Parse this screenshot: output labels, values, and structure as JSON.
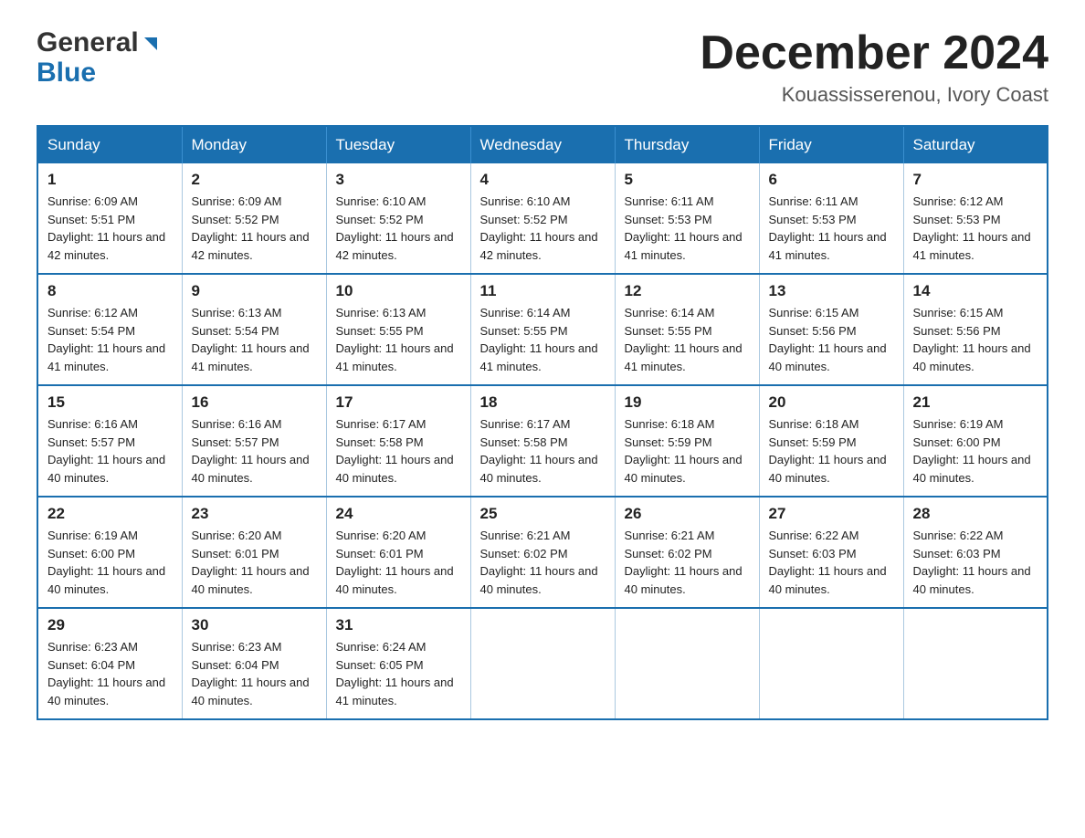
{
  "logo": {
    "general": "General",
    "blue": "Blue"
  },
  "title": {
    "month": "December 2024",
    "location": "Kouassisserenou, Ivory Coast"
  },
  "header_days": [
    "Sunday",
    "Monday",
    "Tuesday",
    "Wednesday",
    "Thursday",
    "Friday",
    "Saturday"
  ],
  "weeks": [
    [
      {
        "num": "1",
        "sunrise": "6:09 AM",
        "sunset": "5:51 PM",
        "daylight": "11 hours and 42 minutes."
      },
      {
        "num": "2",
        "sunrise": "6:09 AM",
        "sunset": "5:52 PM",
        "daylight": "11 hours and 42 minutes."
      },
      {
        "num": "3",
        "sunrise": "6:10 AM",
        "sunset": "5:52 PM",
        "daylight": "11 hours and 42 minutes."
      },
      {
        "num": "4",
        "sunrise": "6:10 AM",
        "sunset": "5:52 PM",
        "daylight": "11 hours and 42 minutes."
      },
      {
        "num": "5",
        "sunrise": "6:11 AM",
        "sunset": "5:53 PM",
        "daylight": "11 hours and 41 minutes."
      },
      {
        "num": "6",
        "sunrise": "6:11 AM",
        "sunset": "5:53 PM",
        "daylight": "11 hours and 41 minutes."
      },
      {
        "num": "7",
        "sunrise": "6:12 AM",
        "sunset": "5:53 PM",
        "daylight": "11 hours and 41 minutes."
      }
    ],
    [
      {
        "num": "8",
        "sunrise": "6:12 AM",
        "sunset": "5:54 PM",
        "daylight": "11 hours and 41 minutes."
      },
      {
        "num": "9",
        "sunrise": "6:13 AM",
        "sunset": "5:54 PM",
        "daylight": "11 hours and 41 minutes."
      },
      {
        "num": "10",
        "sunrise": "6:13 AM",
        "sunset": "5:55 PM",
        "daylight": "11 hours and 41 minutes."
      },
      {
        "num": "11",
        "sunrise": "6:14 AM",
        "sunset": "5:55 PM",
        "daylight": "11 hours and 41 minutes."
      },
      {
        "num": "12",
        "sunrise": "6:14 AM",
        "sunset": "5:55 PM",
        "daylight": "11 hours and 41 minutes."
      },
      {
        "num": "13",
        "sunrise": "6:15 AM",
        "sunset": "5:56 PM",
        "daylight": "11 hours and 40 minutes."
      },
      {
        "num": "14",
        "sunrise": "6:15 AM",
        "sunset": "5:56 PM",
        "daylight": "11 hours and 40 minutes."
      }
    ],
    [
      {
        "num": "15",
        "sunrise": "6:16 AM",
        "sunset": "5:57 PM",
        "daylight": "11 hours and 40 minutes."
      },
      {
        "num": "16",
        "sunrise": "6:16 AM",
        "sunset": "5:57 PM",
        "daylight": "11 hours and 40 minutes."
      },
      {
        "num": "17",
        "sunrise": "6:17 AM",
        "sunset": "5:58 PM",
        "daylight": "11 hours and 40 minutes."
      },
      {
        "num": "18",
        "sunrise": "6:17 AM",
        "sunset": "5:58 PM",
        "daylight": "11 hours and 40 minutes."
      },
      {
        "num": "19",
        "sunrise": "6:18 AM",
        "sunset": "5:59 PM",
        "daylight": "11 hours and 40 minutes."
      },
      {
        "num": "20",
        "sunrise": "6:18 AM",
        "sunset": "5:59 PM",
        "daylight": "11 hours and 40 minutes."
      },
      {
        "num": "21",
        "sunrise": "6:19 AM",
        "sunset": "6:00 PM",
        "daylight": "11 hours and 40 minutes."
      }
    ],
    [
      {
        "num": "22",
        "sunrise": "6:19 AM",
        "sunset": "6:00 PM",
        "daylight": "11 hours and 40 minutes."
      },
      {
        "num": "23",
        "sunrise": "6:20 AM",
        "sunset": "6:01 PM",
        "daylight": "11 hours and 40 minutes."
      },
      {
        "num": "24",
        "sunrise": "6:20 AM",
        "sunset": "6:01 PM",
        "daylight": "11 hours and 40 minutes."
      },
      {
        "num": "25",
        "sunrise": "6:21 AM",
        "sunset": "6:02 PM",
        "daylight": "11 hours and 40 minutes."
      },
      {
        "num": "26",
        "sunrise": "6:21 AM",
        "sunset": "6:02 PM",
        "daylight": "11 hours and 40 minutes."
      },
      {
        "num": "27",
        "sunrise": "6:22 AM",
        "sunset": "6:03 PM",
        "daylight": "11 hours and 40 minutes."
      },
      {
        "num": "28",
        "sunrise": "6:22 AM",
        "sunset": "6:03 PM",
        "daylight": "11 hours and 40 minutes."
      }
    ],
    [
      {
        "num": "29",
        "sunrise": "6:23 AM",
        "sunset": "6:04 PM",
        "daylight": "11 hours and 40 minutes."
      },
      {
        "num": "30",
        "sunrise": "6:23 AM",
        "sunset": "6:04 PM",
        "daylight": "11 hours and 40 minutes."
      },
      {
        "num": "31",
        "sunrise": "6:24 AM",
        "sunset": "6:05 PM",
        "daylight": "11 hours and 41 minutes."
      },
      null,
      null,
      null,
      null
    ]
  ],
  "labels": {
    "sunrise": "Sunrise: ",
    "sunset": "Sunset: ",
    "daylight": "Daylight: "
  }
}
